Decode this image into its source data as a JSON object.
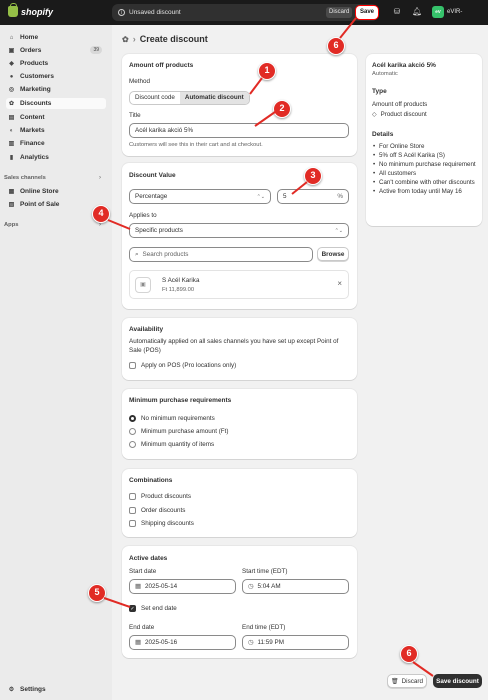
{
  "topbar": {
    "brand": "shopify",
    "unsaved": "Unsaved discount",
    "discard": "Discard",
    "save": "Save",
    "avatar_initials": "eV",
    "store": "eVIR-"
  },
  "sidebar": {
    "items": [
      {
        "label": "Home",
        "icon": "home-icon",
        "glyph": "⌂"
      },
      {
        "label": "Orders",
        "icon": "orders-icon",
        "glyph": "▣",
        "badge": "39"
      },
      {
        "label": "Products",
        "icon": "tag-icon",
        "glyph": "◆"
      },
      {
        "label": "Customers",
        "icon": "person-icon",
        "glyph": "●"
      },
      {
        "label": "Marketing",
        "icon": "target-icon",
        "glyph": "◎"
      },
      {
        "label": "Discounts",
        "icon": "discount-icon",
        "glyph": "✿",
        "active": true
      },
      {
        "label": "Content",
        "icon": "content-icon",
        "glyph": "▤"
      },
      {
        "label": "Markets",
        "icon": "globe-icon",
        "glyph": "◐"
      },
      {
        "label": "Finance",
        "icon": "bank-icon",
        "glyph": "▥"
      },
      {
        "label": "Analytics",
        "icon": "chart-icon",
        "glyph": "▮"
      }
    ],
    "sales_channels_label": "Sales channels",
    "channels": [
      {
        "label": "Online Store",
        "icon": "store-icon",
        "glyph": "▦"
      },
      {
        "label": "Point of Sale",
        "icon": "pos-icon",
        "glyph": "▧"
      }
    ],
    "apps_label": "Apps",
    "settings": "Settings"
  },
  "page": {
    "title": "Create discount"
  },
  "amount_card": {
    "title": "Amount off products",
    "method_label": "Method",
    "method_options": [
      "Discount code",
      "Automatic discount"
    ],
    "method_selected": "Automatic discount",
    "title_label": "Title",
    "title_value": "Acél karika akció 5%",
    "title_help": "Customers will see this in their cart and at checkout."
  },
  "value_card": {
    "title": "Discount Value",
    "type_value": "Percentage",
    "amount_value": "5",
    "amount_suffix": "%",
    "applies_label": "Applies to",
    "applies_value": "Specific products",
    "search_placeholder": "Search products",
    "browse": "Browse",
    "product_name": "S Acél Karika",
    "product_price": "Ft 11,899.00"
  },
  "availability": {
    "title": "Availability",
    "text": "Automatically applied on all sales channels you have set up except Point of Sale (POS)",
    "pos_label": "Apply on POS (Pro locations only)"
  },
  "min_req": {
    "title": "Minimum purchase requirements",
    "options": [
      "No minimum requirements",
      "Minimum purchase amount (Ft)",
      "Minimum quantity of items"
    ],
    "selected": 0
  },
  "combinations": {
    "title": "Combinations",
    "options": [
      "Product discounts",
      "Order discounts",
      "Shipping discounts"
    ]
  },
  "active_dates": {
    "title": "Active dates",
    "start_date_label": "Start date",
    "start_date": "2025-05-14",
    "start_time_label": "Start time (EDT)",
    "start_time": "5:04 AM",
    "set_end_label": "Set end date",
    "end_date_label": "End date",
    "end_date": "2025-05-16",
    "end_time_label": "End time (EDT)",
    "end_time": "11:59 PM"
  },
  "summary": {
    "name": "Acél karika akció 5%",
    "kind": "Automatic",
    "type_heading": "Type",
    "type_value": "Amount off products",
    "type_sub": "Product discount",
    "details_heading": "Details",
    "details": [
      "For Online Store",
      "5% off S Acél Karika (S)",
      "No minimum purchase requirement",
      "All customers",
      "Can't combine with other discounts",
      "Active from today until May 16"
    ]
  },
  "footer": {
    "discard": "Discard",
    "save": "Save discount"
  },
  "callouts": [
    "1",
    "2",
    "3",
    "4",
    "5",
    "6",
    "6"
  ],
  "colors": {
    "callout": "#e12b25",
    "topbar": "#1a1a1a",
    "primary_button": "#303030",
    "avatar": "#36c26b"
  }
}
